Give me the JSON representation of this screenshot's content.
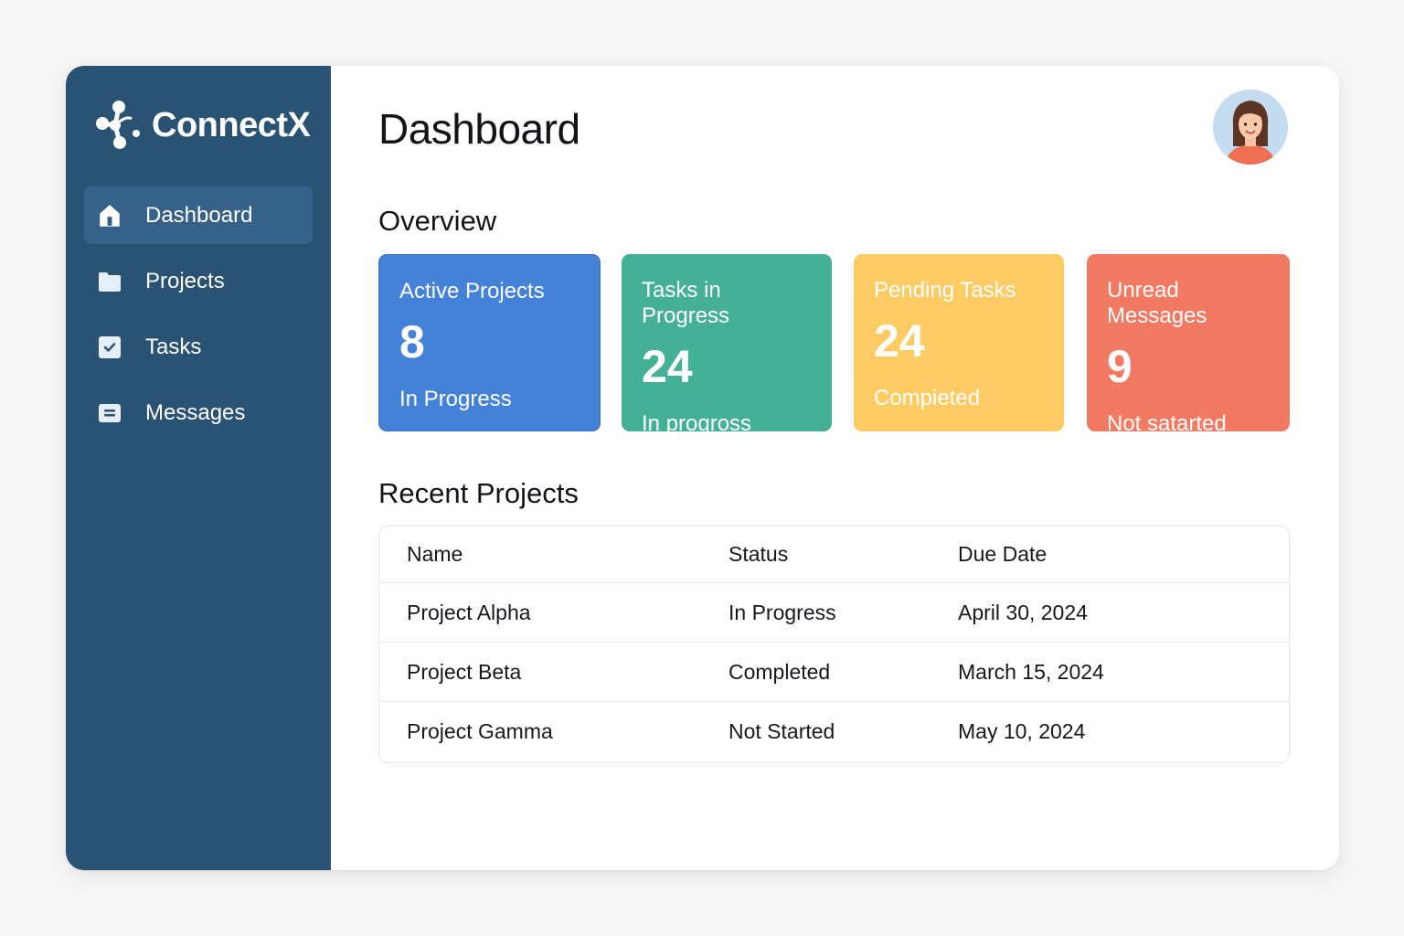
{
  "app": {
    "name": "ConnectX"
  },
  "sidebar": {
    "items": [
      {
        "label": "Dashboard",
        "icon": "home-icon",
        "active": true
      },
      {
        "label": "Projects",
        "icon": "folder-icon",
        "active": false
      },
      {
        "label": "Tasks",
        "icon": "checkbox-icon",
        "active": false
      },
      {
        "label": "Messages",
        "icon": "message-icon",
        "active": false
      }
    ]
  },
  "header": {
    "title": "Dashboard",
    "avatar_icon": "user-avatar"
  },
  "overview": {
    "title": "Overview",
    "cards": [
      {
        "title": "Active Projects",
        "value": "8",
        "subtitle": "In Progress",
        "color": "#4481d9"
      },
      {
        "title": "Tasks in Progress",
        "value": "24",
        "subtitle": "In progross",
        "color": "#44b096"
      },
      {
        "title": "Pending Tasks",
        "value": "24",
        "subtitle": "Compieted",
        "color": "#fccb63"
      },
      {
        "title": "Unread Messages",
        "value": "9",
        "subtitle": "Not satarted",
        "color": "#f27a62"
      }
    ]
  },
  "recent_projects": {
    "title": "Recent Projects",
    "columns": [
      "Name",
      "Status",
      "Due Date"
    ],
    "rows": [
      {
        "name": "Project Alpha",
        "status": "In Progress",
        "due": "April 30, 2024"
      },
      {
        "name": "Project Beta",
        "status": "Completed",
        "due": "March 15, 2024"
      },
      {
        "name": "Project Gamma",
        "status": "Not Started",
        "due": "May 10, 2024"
      }
    ]
  },
  "colors": {
    "sidebar_bg": "#2a5273",
    "sidebar_active": "#36628a"
  }
}
